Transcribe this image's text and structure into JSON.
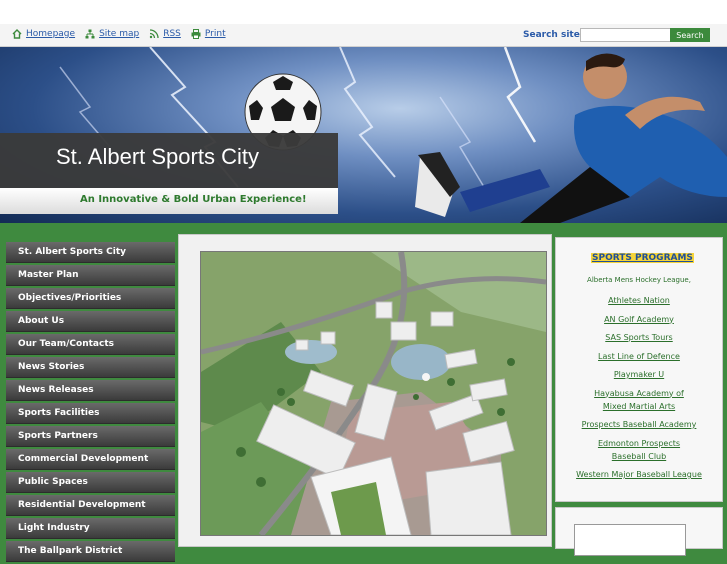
{
  "toplinks": [
    {
      "label": "Homepage",
      "icon": "home-icon"
    },
    {
      "label": "Site map",
      "icon": "sitemap-icon"
    },
    {
      "label": "RSS",
      "icon": "rss-icon"
    },
    {
      "label": "Print",
      "icon": "print-icon"
    }
  ],
  "search": {
    "label": "Search site:",
    "placeholder": "",
    "button": "Search"
  },
  "banner": {
    "title": "St. Albert Sports City",
    "tagline": "An Innovative & Bold Urban Experience!"
  },
  "nav": [
    "St. Albert Sports City",
    "Master Plan",
    "Objectives/Priorities",
    "About Us",
    "Our Team/Contacts",
    "News Stories",
    "News Releases",
    "Sports Facilities",
    "Sports Partners",
    "Commercial Development",
    "Public Spaces",
    "Residential Development",
    "Light Industry",
    "The Ballpark District"
  ],
  "side": {
    "title": "SPORTS PROGRAMS",
    "items": [
      "Alberta Mens Hockey League,",
      "Athletes Nation",
      "AN Golf Academy",
      "SAS Sports Tours",
      "Last Line of Defence",
      "Playmaker U",
      "Hayabusa Academy of Mixed Martial Arts",
      "Prospects Baseball Academy",
      "Edmonton Prospects Baseball Club",
      "Western Major Baseball League"
    ]
  },
  "colors": {
    "accent": "#3c8a3c",
    "nav_bg": "#3b3b3b",
    "link": "#2a5aa8",
    "highlight": "#f5d43a"
  }
}
